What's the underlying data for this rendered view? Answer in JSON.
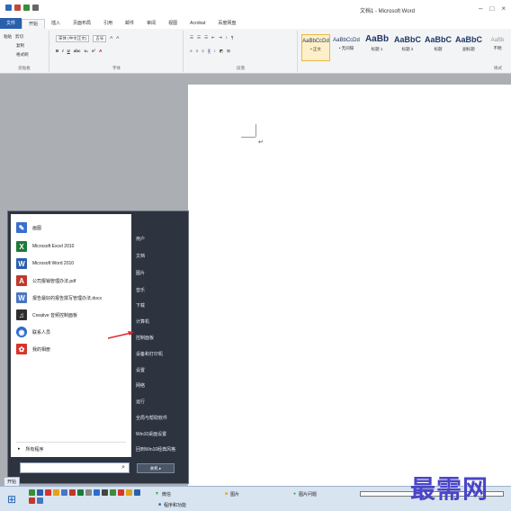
{
  "window": {
    "title": "文档1 - Microsoft Word"
  },
  "ribbon": {
    "tabs": [
      "文件",
      "开始",
      "插入",
      "页面布局",
      "引用",
      "邮件",
      "审阅",
      "视图",
      "Acrobat",
      "百度网盘"
    ],
    "clipboard": {
      "paste_label": "粘贴",
      "cut_label": "剪切",
      "copy_label": "复制",
      "format_painter_label": "格式刷",
      "group_label": "剪贴板"
    },
    "font": {
      "font_name": "宋体 (中文正文)",
      "font_size": "五号",
      "group_label": "字体"
    },
    "paragraph": {
      "group_label": "段落"
    },
    "styles": {
      "group_label": "样式",
      "items": [
        {
          "sample": "AaBbCcDd",
          "name": "• 正文"
        },
        {
          "sample": "AaBbCcDd",
          "name": "• 无间隔"
        },
        {
          "sample": "AaBb",
          "name": "标题 1"
        },
        {
          "sample": "AaBbC",
          "name": "标题 2"
        },
        {
          "sample": "AaBbC",
          "name": "标题"
        },
        {
          "sample": "AaBbC",
          "name": "副标题"
        },
        {
          "sample": "AaBb",
          "name": "不明"
        }
      ]
    }
  },
  "start_menu": {
    "left_items": [
      {
        "label": "画图",
        "icon": "paint-icon",
        "color": "#3a6fd0"
      },
      {
        "label": "Microsoft Excel 2010",
        "icon": "excel-icon",
        "color": "#1e7a3a"
      },
      {
        "label": "Microsoft Word 2010",
        "icon": "word-icon",
        "color": "#2a5fac"
      },
      {
        "label": "公司报销管理办法.pdf",
        "icon": "pdf-icon",
        "color": "#c0392b"
      },
      {
        "label": "报告最好的报告撰写管理办法.docx",
        "icon": "docx-icon",
        "color": "#4a76c0"
      },
      {
        "label": "Creative 音频控制面板",
        "icon": "creative-icon",
        "color": "#2f2f2f"
      },
      {
        "label": "联系人员",
        "icon": "contact-icon",
        "color": "#2b6cd1"
      },
      {
        "label": "我的相册",
        "icon": "album-icon",
        "color": "#d8342a"
      }
    ],
    "all_programs": "所有程序",
    "right_items": [
      "用户",
      "文档",
      "图片",
      "音乐",
      "下载",
      "计算机",
      "控制面板",
      "设备和打印机",
      "设置",
      "网络",
      "运行",
      "全局与帮助软件",
      "Win10桌面设置",
      "回到Win10经典风格"
    ],
    "shutdown_label": "关机 ▸"
  },
  "taskbar": {
    "start_label": "开始",
    "items": [
      "微信",
      "图片",
      "图片问题",
      "程序和功能"
    ]
  },
  "watermark": "最需网"
}
